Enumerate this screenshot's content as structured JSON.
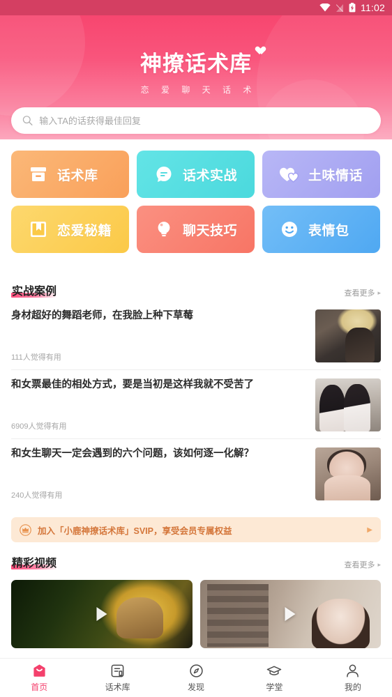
{
  "statusbar": {
    "time": "11:02",
    "wifi_icon": "wifi-icon",
    "signal_icon": "signal-off-icon",
    "battery_icon": "battery-charging-icon"
  },
  "header": {
    "logo_title": "神撩话术库",
    "logo_subtitle": "恋 爱 聊 天 话 术",
    "heart_icon": "heart-icon",
    "accent_color": "#f7466f"
  },
  "search": {
    "placeholder": "输入TA的话获得最佳回复",
    "icon": "search-icon"
  },
  "categories": [
    {
      "label": "话术库",
      "icon": "archive-box-icon",
      "color": "#f9a85f",
      "color2": "#fbb878"
    },
    {
      "label": "话术实战",
      "icon": "chat-bubble-icon",
      "color": "#4fdde0",
      "color2": "#63e4e6"
    },
    {
      "label": "土味情话",
      "icon": "double-heart-icon",
      "color": "#a8a7f2",
      "color2": "#b8b7f6"
    },
    {
      "label": "恋爱秘籍",
      "icon": "book-icon",
      "color": "#fbcf55",
      "color2": "#fdd86e"
    },
    {
      "label": "聊天技巧",
      "icon": "lightbulb-icon",
      "color": "#f97f6e",
      "color2": "#fa9081"
    },
    {
      "label": "表情包",
      "icon": "smiley-icon",
      "color": "#5eb3f5",
      "color2": "#73bef7"
    }
  ],
  "sections": {
    "cases": {
      "title": "实战案例",
      "more_label": "查看更多",
      "more_arrow": "▸",
      "items": [
        {
          "title": "身材超好的舞蹈老师，在我脸上种下草莓",
          "meta": "111人觉得有用",
          "thumb": "thumb-dance-teacher"
        },
        {
          "title": "和女票最佳的相处方式，要是当初是这样我就不受苦了",
          "meta": "6909人觉得有用",
          "thumb": "thumb-couple"
        },
        {
          "title": "和女生聊天一定会遇到的六个问题，该如何逐一化解？",
          "meta": "240人觉得有用",
          "thumb": "thumb-girl-portrait"
        }
      ]
    },
    "videos": {
      "title": "精彩视频",
      "more_label": "查看更多",
      "more_arrow": "▸",
      "items": [
        {
          "thumb": "video-thumb-gold-hat",
          "play_icon": "play-icon"
        },
        {
          "thumb": "video-thumb-street-girl",
          "play_icon": "play-icon"
        }
      ]
    }
  },
  "svip_banner": {
    "text": "加入「小鹿神撩话术库」SVIP，享受会员专属权益",
    "icon": "crown-icon",
    "arrow": "▶",
    "bg_color": "#fde9d5",
    "text_color": "#d4763a"
  },
  "tabbar": {
    "active_color": "#f4406c",
    "items": [
      {
        "label": "首页",
        "icon": "home-icon",
        "active": true
      },
      {
        "label": "话术库",
        "icon": "library-icon",
        "active": false
      },
      {
        "label": "发现",
        "icon": "compass-icon",
        "active": false
      },
      {
        "label": "学堂",
        "icon": "graduation-cap-icon",
        "active": false
      },
      {
        "label": "我的",
        "icon": "user-icon",
        "active": false
      }
    ]
  }
}
